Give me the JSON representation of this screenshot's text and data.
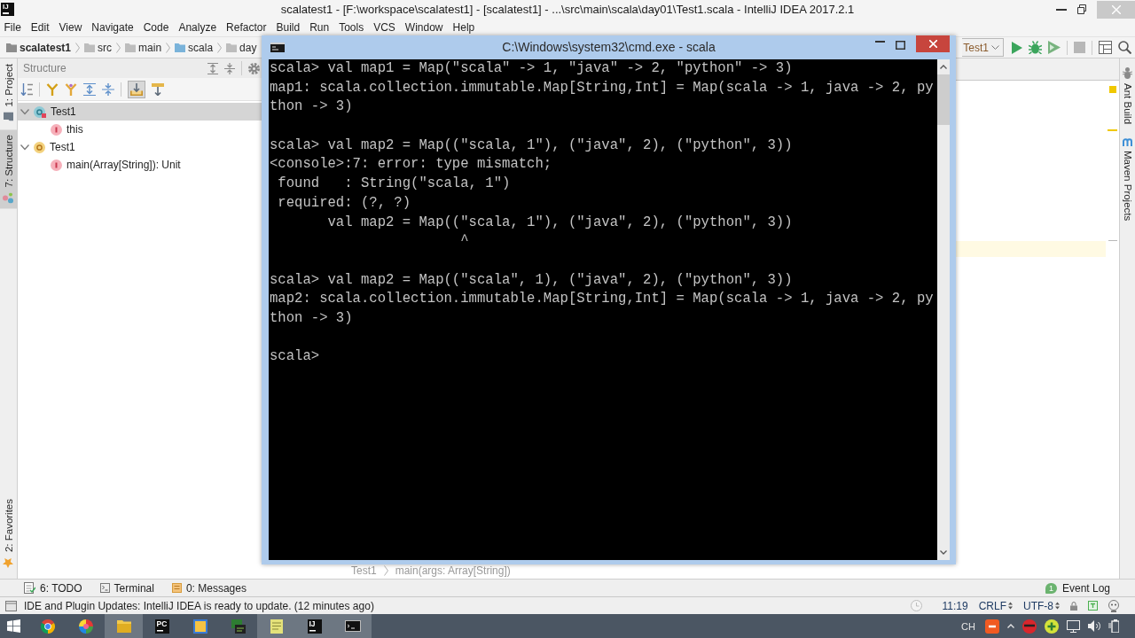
{
  "window": {
    "logo": "IJ",
    "title": "scalatest1 - [F:\\workspace\\scalatest1] - [scalatest1] - ...\\src\\main\\scala\\day01\\Test1.scala - IntelliJ IDEA 2017.2.1"
  },
  "menu": [
    "File",
    "Edit",
    "View",
    "Navigate",
    "Code",
    "Analyze",
    "Refactor",
    "Build",
    "Run",
    "Tools",
    "VCS",
    "Window",
    "Help"
  ],
  "navbar": {
    "breadcrumbs": [
      {
        "label": "scalatest1",
        "kind": "project"
      },
      {
        "label": "src",
        "kind": "folder"
      },
      {
        "label": "main",
        "kind": "folder"
      },
      {
        "label": "scala",
        "kind": "source"
      },
      {
        "label": "day",
        "kind": "folder"
      }
    ],
    "run_config": "Test1",
    "tools": [
      [
        {
          "kind": "run",
          "disabled": false
        },
        {
          "kind": "debug",
          "disabled": false
        },
        {
          "kind": "coverage",
          "disabled": false
        }
      ],
      [
        {
          "kind": "stop",
          "disabled": true
        }
      ],
      [
        {
          "kind": "project-structure",
          "disabled": false
        },
        {
          "kind": "search",
          "disabled": false
        }
      ]
    ]
  },
  "left_strip": {
    "top": [
      {
        "label": "1: Project",
        "kind": "project",
        "selected": false
      },
      {
        "label": "7: Structure",
        "kind": "structure",
        "selected": true
      }
    ],
    "bottom": [
      {
        "label": "2: Favorites",
        "kind": "favorites",
        "selected": false
      }
    ]
  },
  "structure_panel": {
    "title": "Structure",
    "toolbar": [
      [
        {
          "kind": "sort",
          "pressed": false
        }
      ],
      [
        {
          "kind": "inherited",
          "pressed": false
        },
        {
          "kind": "fields",
          "pressed": false
        },
        {
          "kind": "expand",
          "pressed": false
        },
        {
          "kind": "collapse",
          "pressed": false
        }
      ],
      [
        {
          "kind": "autoscroll-to-source",
          "pressed": true
        },
        {
          "kind": "autoscroll-from-source",
          "pressed": false
        }
      ]
    ],
    "tree": [
      {
        "label": "Test1",
        "kind": "class",
        "expanded": true,
        "selected": true,
        "children": [
          {
            "label": "this",
            "kind": "member",
            "selected": false
          }
        ]
      },
      {
        "label": "Test1",
        "kind": "object",
        "expanded": true,
        "selected": false,
        "children": [
          {
            "label": "main(Array[String]): Unit",
            "kind": "member",
            "selected": false
          }
        ]
      }
    ]
  },
  "editor": {
    "breadcrumbs": [
      "Test1",
      "main(args: Array[String])"
    ]
  },
  "right_strip": [
    {
      "label": "Ant Build",
      "kind": "ant"
    },
    {
      "label": "Maven Projects",
      "kind": "maven"
    }
  ],
  "tool_tabs": [
    {
      "label": "6: TODO",
      "kind": "todo"
    },
    {
      "label": "Terminal",
      "kind": "terminal"
    },
    {
      "label": "0: Messages",
      "kind": "messages"
    }
  ],
  "event_log": {
    "label": "Event Log",
    "count": "1"
  },
  "status_bar": {
    "message": "IDE and Plugin Updates: IntelliJ IDEA is ready to update. (12 minutes ago)",
    "position": "11:19",
    "line_separator": "CRLF",
    "encoding": "UTF-8"
  },
  "console_window": {
    "title": "C:\\Windows\\system32\\cmd.exe - scala",
    "blocks": [
      [
        "scala> val map1 = Map(\"scala\" -> 1, \"java\" -> 2, \"python\" -> 3)",
        "map1: scala.collection.immutable.Map[String,Int] = Map(scala -> 1, java -> 2, py",
        "thon -> 3)"
      ],
      [
        "scala> val map2 = Map((\"scala, 1\"), (\"java\", 2), (\"python\", 3))",
        "<console>:7: error: type mismatch;",
        " found   : String(\"scala, 1\")",
        " required: (?, ?)",
        "       val map2 = Map((\"scala, 1\"), (\"java\", 2), (\"python\", 3))",
        "                       ^"
      ],
      [
        "scala> val map2 = Map((\"scala\", 1), (\"java\", 2), (\"python\", 3))",
        "map2: scala.collection.immutable.Map[String,Int] = Map(scala -> 1, java -> 2, py",
        "thon -> 3)"
      ],
      [
        "scala>"
      ]
    ]
  },
  "taskbar": {
    "apps": [
      {
        "kind": "browser",
        "running": false
      },
      {
        "kind": "ball",
        "running": false
      },
      {
        "kind": "folder",
        "running": true
      },
      {
        "kind": "ide",
        "badge": "PC",
        "running": false
      },
      {
        "kind": "square-app",
        "running": false
      },
      {
        "kind": "stack-app",
        "running": false
      },
      {
        "kind": "notepad",
        "running": true
      },
      {
        "kind": "ide",
        "badge": "IJ",
        "running": true
      },
      {
        "kind": "console",
        "running": true
      }
    ],
    "tray": {
      "language": "CH",
      "icons": [
        {
          "kind": "ime"
        },
        {
          "kind": "chevron"
        },
        {
          "kind": "red-ball"
        },
        {
          "kind": "green-plus"
        },
        {
          "kind": "network"
        },
        {
          "kind": "volume"
        },
        {
          "kind": "power"
        }
      ]
    }
  }
}
